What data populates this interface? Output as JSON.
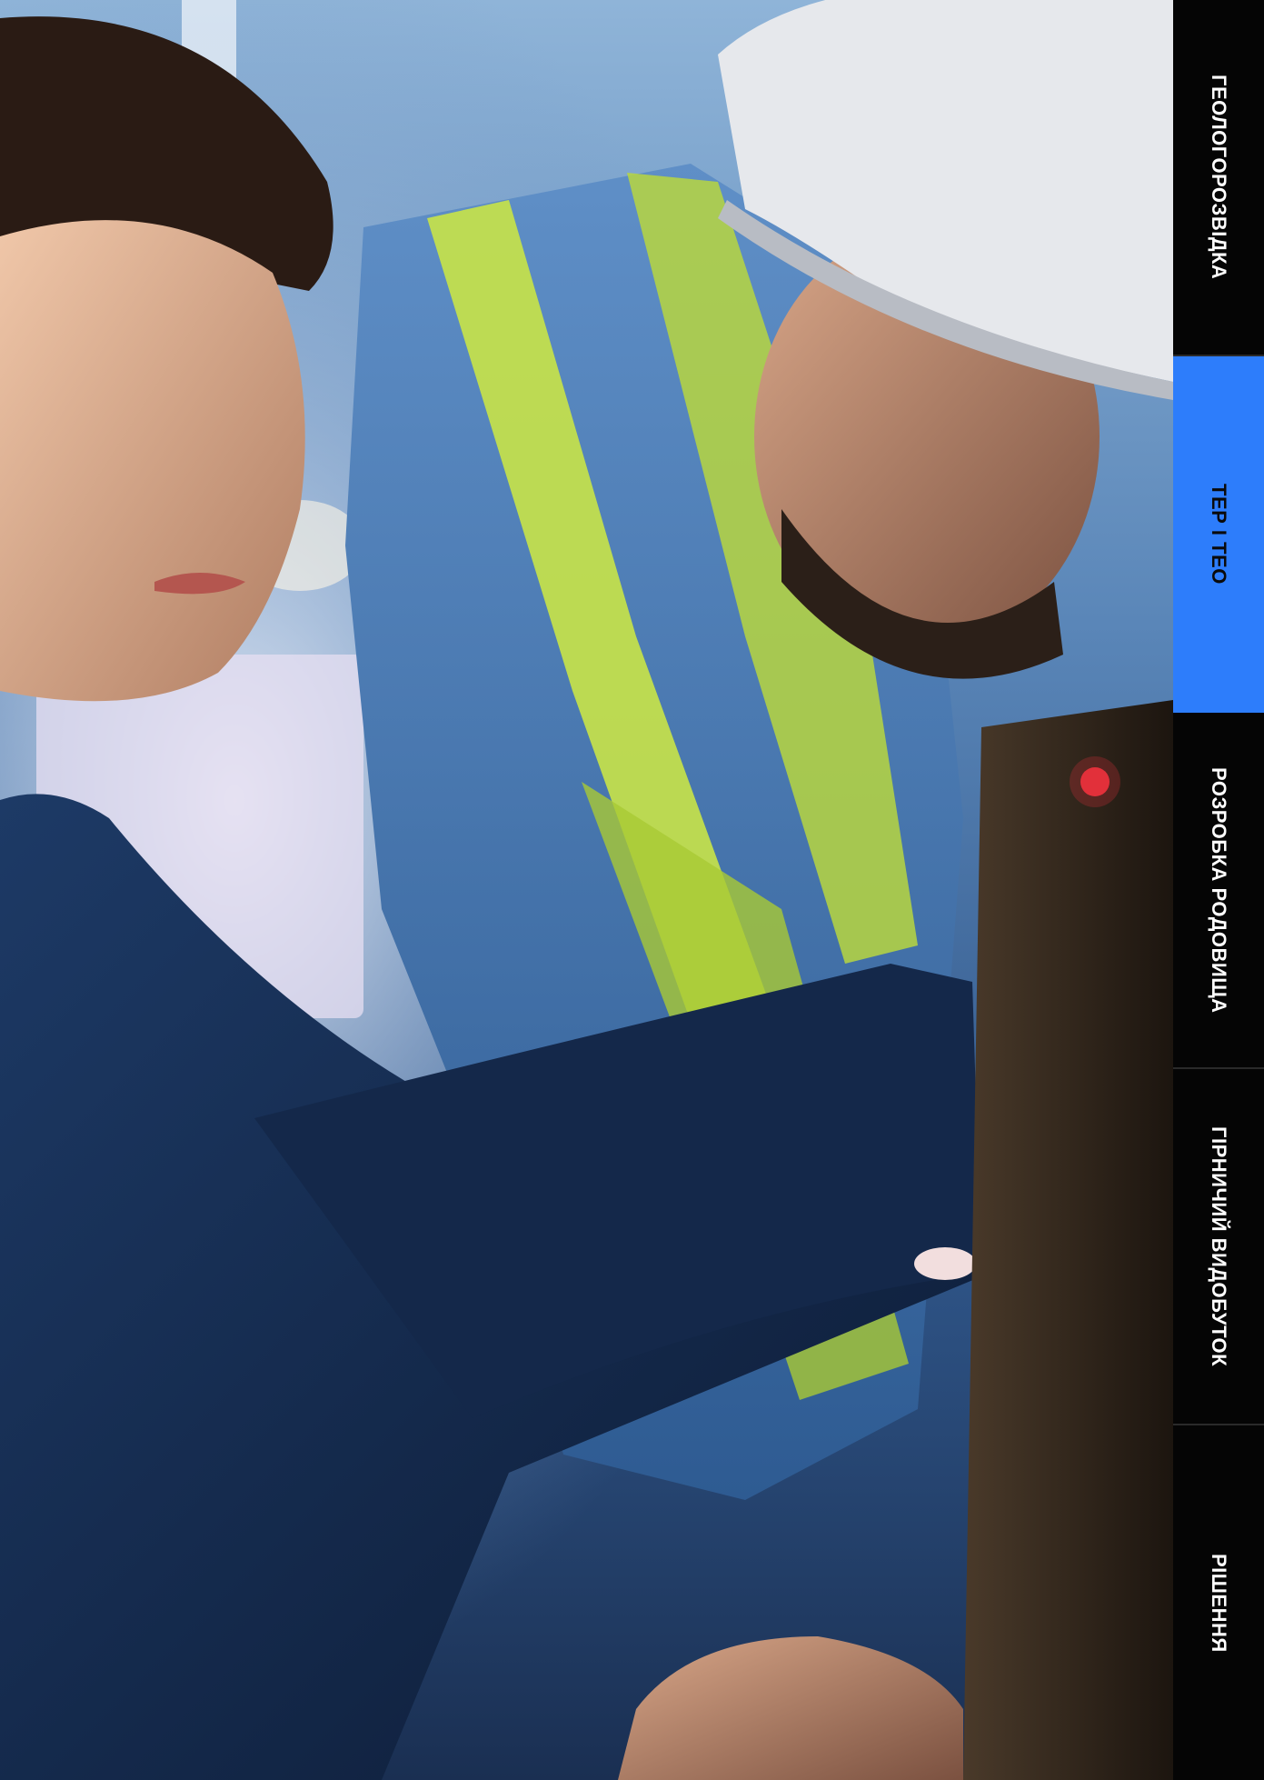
{
  "hero": {
    "image_description_icon": "photo-engineers-at-monitor"
  },
  "nav": {
    "accent_color": "#2d7dfb",
    "tabs": [
      {
        "label": "ГЕОЛОГОРОЗВІДКА",
        "active": false
      },
      {
        "label": "ТЕР І ТЕО",
        "active": true
      },
      {
        "label": "РОЗРОБКА РОДОВИЩА",
        "active": false
      },
      {
        "label": "ГІРНИЧИЙ ВИДОБУТОК",
        "active": false
      },
      {
        "label": "РІШЕННЯ",
        "active": false
      }
    ]
  }
}
